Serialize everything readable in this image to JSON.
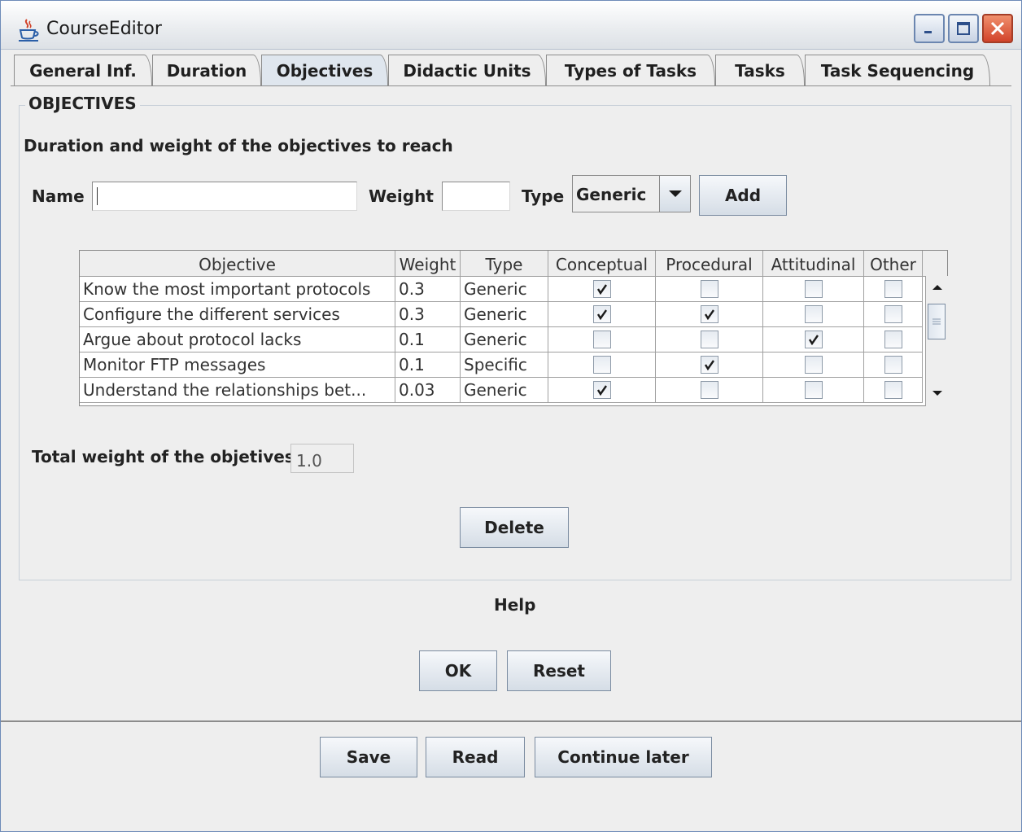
{
  "window": {
    "title": "CourseEditor"
  },
  "tabs": [
    {
      "label": "General Inf."
    },
    {
      "label": "Duration"
    },
    {
      "label": "Objectives"
    },
    {
      "label": "Didactic Units"
    },
    {
      "label": "Types of Tasks"
    },
    {
      "label": "Tasks"
    },
    {
      "label": "Task Sequencing"
    }
  ],
  "active_tab": "Objectives",
  "objectives": {
    "group_title": "OBJECTIVES",
    "heading": "Duration and weight of the objectives to reach",
    "name_label": "Name",
    "name_value": "",
    "weight_label": "Weight",
    "weight_value": "",
    "type_label": "Type",
    "type_value": "Generic",
    "add_button": "Add",
    "table": {
      "headers": [
        "Objective",
        "Weight",
        "Type",
        "Conceptual",
        "Procedural",
        "Attitudinal",
        "Other"
      ],
      "rows": [
        {
          "objective": "Know the most important protocols",
          "weight": "0.3",
          "type": "Generic",
          "conceptual": true,
          "procedural": false,
          "attitudinal": false,
          "other": false
        },
        {
          "objective": "Configure the different services",
          "weight": "0.3",
          "type": "Generic",
          "conceptual": true,
          "procedural": true,
          "attitudinal": false,
          "other": false
        },
        {
          "objective": "Argue about protocol lacks",
          "weight": "0.1",
          "type": "Generic",
          "conceptual": false,
          "procedural": false,
          "attitudinal": true,
          "other": false
        },
        {
          "objective": "Monitor FTP messages",
          "weight": "0.1",
          "type": "Specific",
          "conceptual": false,
          "procedural": true,
          "attitudinal": false,
          "other": false
        },
        {
          "objective": "Understand the relationships bet...",
          "weight": "0.03",
          "type": "Generic",
          "conceptual": true,
          "procedural": false,
          "attitudinal": false,
          "other": false
        }
      ]
    },
    "total_label": "Total weight of the objetives",
    "total_value": "1.0",
    "delete_button": "Delete"
  },
  "help_label": "Help",
  "ok_button": "OK",
  "reset_button": "Reset",
  "footer": {
    "save_button": "Save",
    "read_button": "Read",
    "continue_button": "Continue later"
  },
  "colors": {
    "accent_border": "#6d8bb8",
    "close_button": "#d2432a"
  }
}
